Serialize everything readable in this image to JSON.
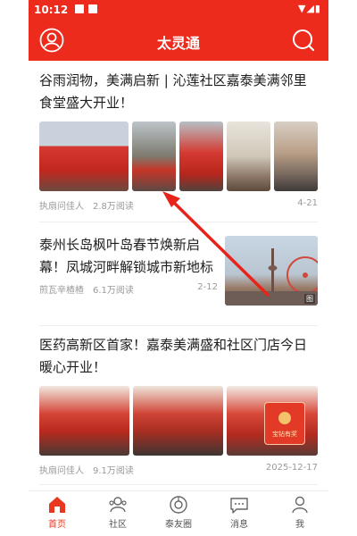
{
  "status_bar": {
    "time": "10:12"
  },
  "header": {
    "title": "太灵通"
  },
  "articles": [
    {
      "title": "谷雨润物，美满启新 | 沁莲社区嘉泰美满邻里食堂盛大开业！",
      "publisher": "执扇问佳人",
      "reads": "2.8万阅读",
      "date": "4-21"
    },
    {
      "title": "泰州长岛枫叶岛春节焕新启幕！凤城河畔解锁城市新地标",
      "publisher": "煎瓦辛楂楂",
      "reads": "6.1万阅读",
      "date": "2-12",
      "image_badge": "图"
    },
    {
      "title": "医药高新区首家！嘉泰美满盛和社区门店今日暖心开业！",
      "publisher": "执扇问佳人",
      "reads": "9.1万阅读",
      "date": "2025-12-17",
      "image_badge": "宝钻有奖"
    }
  ],
  "tabbar": {
    "items": [
      {
        "label": "首页",
        "icon": "home-icon"
      },
      {
        "label": "社区",
        "icon": "community-icon"
      },
      {
        "label": "泰友圈",
        "icon": "moments-icon"
      },
      {
        "label": "消息",
        "icon": "message-icon"
      },
      {
        "label": "我",
        "icon": "profile-icon"
      }
    ]
  },
  "colors": {
    "brand": "#ec2b1c",
    "annotation_arrow": "#e8231a"
  }
}
